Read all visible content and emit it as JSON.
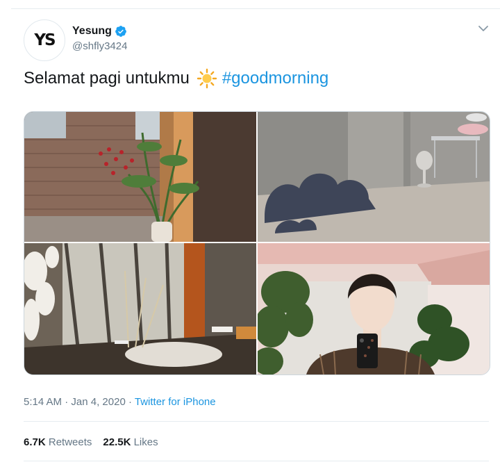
{
  "tweet": {
    "avatar_text": "YS",
    "display_name": "Yesung",
    "handle": "@shfly3424",
    "text_before": "Selamat pagi untukmu",
    "hashtag": "#goodmorning",
    "time": "5:14 AM",
    "date": "Jan 4, 2020",
    "separator": "·",
    "source": "Twitter for iPhone",
    "retweets_count": "6.7K",
    "retweets_label": "Retweets",
    "likes_count": "22.5K",
    "likes_label": "Likes"
  },
  "icons": [
    "verified-badge-icon",
    "chevron-down-icon",
    "sun-emoji-icon"
  ],
  "colors": {
    "link": "#1b95e0",
    "muted": "#657786",
    "text": "#14171a",
    "border": "#e6ecf0"
  }
}
